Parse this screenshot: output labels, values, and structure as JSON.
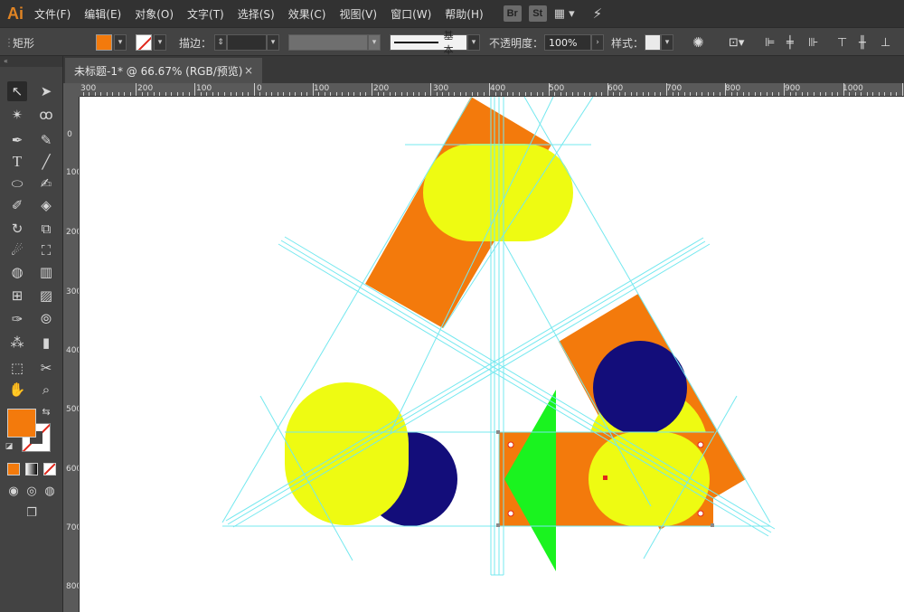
{
  "app": {
    "logo": "Ai",
    "menu": [
      "文件(F)",
      "编辑(E)",
      "对象(O)",
      "文字(T)",
      "选择(S)",
      "效果(C)",
      "视图(V)",
      "窗口(W)",
      "帮助(H)"
    ],
    "bridge_label": "Br",
    "stock_label": "St"
  },
  "control": {
    "object_type": "矩形",
    "stroke_label": "描边：",
    "stroke_profile": "基本",
    "opacity_label": "不透明度：",
    "opacity_value": "100%",
    "style_label": "样式：",
    "fill_color": "#f37a0c"
  },
  "document": {
    "tab_title": "未标题-1* @ 66.67% (RGB/预览)",
    "close": "×"
  },
  "rulers": {
    "top": [
      "300",
      "200",
      "100",
      "0",
      "100",
      "200",
      "300",
      "400",
      "500",
      "600",
      "700",
      "800",
      "900",
      "1000"
    ],
    "left": [
      "0",
      "100",
      "200",
      "300",
      "400",
      "500",
      "600",
      "700",
      "800"
    ]
  },
  "colors": {
    "orange": "#f37a0c",
    "yellow": "#eefb12",
    "navy": "#130d7a",
    "green": "#1af31f",
    "guide": "#74e8ef"
  }
}
